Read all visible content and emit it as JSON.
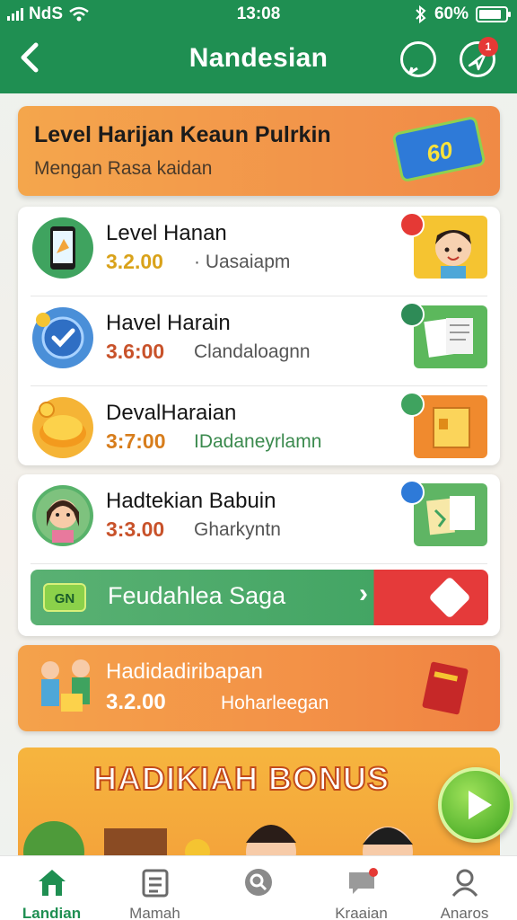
{
  "status_bar": {
    "carrier": "NdS",
    "time": "13:08",
    "battery": "60%"
  },
  "header": {
    "title": "Nandesian",
    "notification_count": "1"
  },
  "banner": {
    "title": "Level Harijan Keaun Pulrkin",
    "subtitle": "Mengan Rasa kaidan",
    "badge": "60"
  },
  "tasks": [
    {
      "name": "Level Hanan",
      "points": "3.2.00",
      "points_color": "#d9a21a",
      "desc": "Uasaiapm",
      "icon": "phone-icon"
    },
    {
      "name": "Havel Harain",
      "points": "3.6:00",
      "points_color": "#c8522a",
      "desc": "Clandaloagnn",
      "icon": "check-badge-icon"
    },
    {
      "name": "DevalHaraian",
      "points": "3:7:00",
      "points_color": "#d77d1c",
      "desc": "IDadaneyrlamn",
      "icon": "gold-coin-icon"
    },
    {
      "name": "Hadtekian Babuin",
      "points": "3:3.00",
      "points_color": "#c8522a",
      "desc": "Gharkyntn",
      "icon": "girl-avatar-icon"
    }
  ],
  "cta": {
    "tag": "GN",
    "label": "Feudahlea Saga"
  },
  "promo": {
    "title": "Hadidadiribapan",
    "points": "3.2.00",
    "desc": "Hoharleegan"
  },
  "bonus": {
    "title": "HADIKIAH BONUS"
  },
  "bottom_nav": [
    {
      "label": "Landian",
      "icon": "home-icon",
      "active": true
    },
    {
      "label": "Mamah",
      "icon": "clipboard-icon",
      "active": false
    },
    {
      "label": "",
      "icon": "search-icon",
      "active": false
    },
    {
      "label": "Kraaian",
      "icon": "chat-icon",
      "active": false
    },
    {
      "label": "Anaros",
      "icon": "profile-icon",
      "active": false
    }
  ],
  "colors": {
    "primary_green": "#1f8f52",
    "accent_orange": "#f39147",
    "alert_red": "#e53935"
  }
}
